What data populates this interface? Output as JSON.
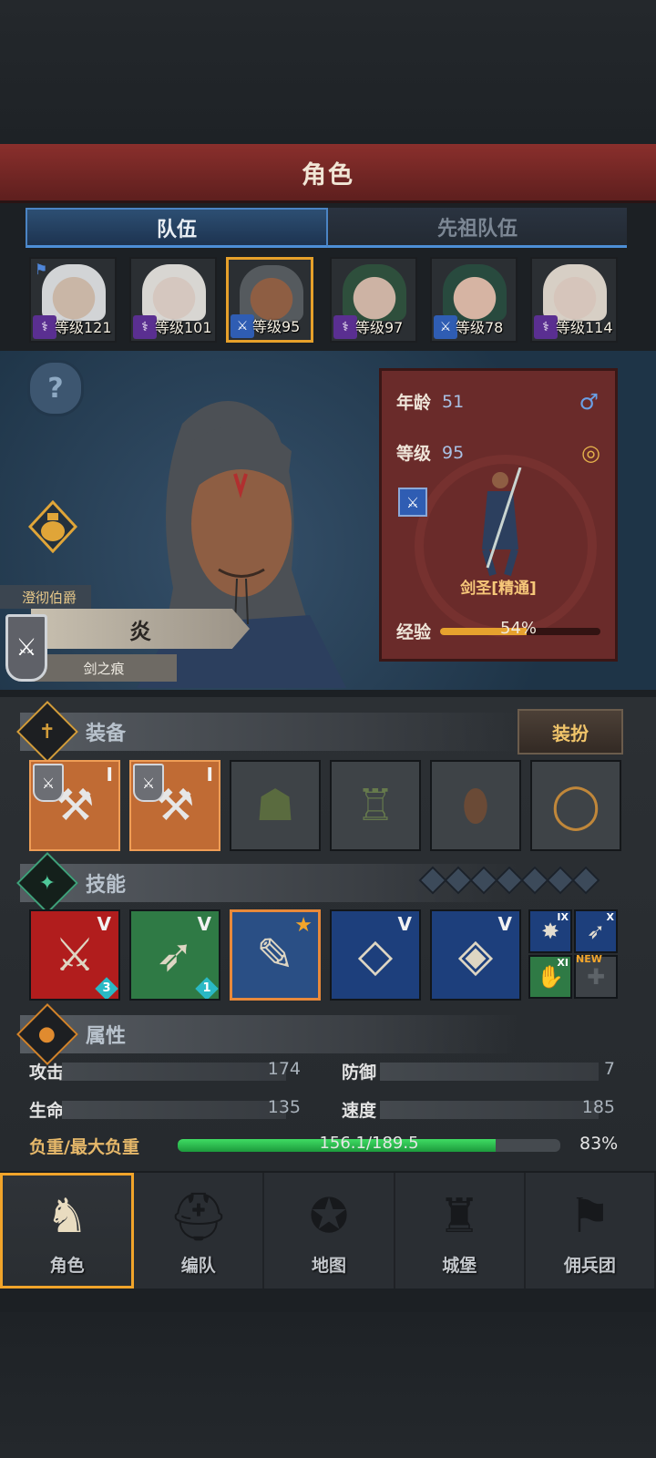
{
  "header": {
    "title": "角色"
  },
  "tabs": [
    {
      "label": "队伍",
      "active": true
    },
    {
      "label": "先祖队伍",
      "active": false
    }
  ],
  "party": [
    {
      "level_text": "等级121",
      "class_icon": "staff-icon",
      "flag": true,
      "hair": "#d2d4d6",
      "skin": "#c9b6a6"
    },
    {
      "level_text": "等级101",
      "class_icon": "staff-icon",
      "flag": false,
      "hair": "#d8d6d2",
      "skin": "#d5c7bf"
    },
    {
      "level_text": "等级95",
      "class_icon": "sword-icon",
      "flag": false,
      "hair": "#555a5e",
      "skin": "#8e5e43",
      "selected": true
    },
    {
      "level_text": "等级97",
      "class_icon": "staff-icon",
      "flag": false,
      "hair": "#2e4f3c",
      "skin": "#cdb3a4"
    },
    {
      "level_text": "等级78",
      "class_icon": "sword-icon",
      "flag": false,
      "hair": "#284a3e",
      "skin": "#d6b4a3"
    },
    {
      "level_text": "等级114",
      "class_icon": "staff-icon",
      "flag": false,
      "hair": "#d7cfc5",
      "skin": "#d6c5bb"
    }
  ],
  "hero": {
    "noble_title": "澄彻伯爵",
    "name": "炎",
    "epithet": "剑之痕"
  },
  "card": {
    "age_label": "年龄",
    "age": "51",
    "level_label": "等级",
    "level": "95",
    "class_name": "剑圣[精通]",
    "exp_label": "经验",
    "exp_pct_text": "54%",
    "exp_fraction": 0.54
  },
  "equipment": {
    "title": "装备",
    "dress_button": "装扮",
    "slots": [
      {
        "icon": "weapon-axe-icon",
        "tier": "I",
        "rarity": "orange"
      },
      {
        "icon": "weapon-axe-icon",
        "tier": "I",
        "rarity": "orange"
      },
      {
        "icon": "hood-icon",
        "tier": "",
        "rarity": "gray"
      },
      {
        "icon": "armor-icon",
        "tier": "",
        "rarity": "gray"
      },
      {
        "icon": "boots-icon",
        "tier": "",
        "rarity": "gray"
      },
      {
        "icon": "ring-icon",
        "tier": "",
        "rarity": "gray"
      }
    ]
  },
  "skills": {
    "title": "技能",
    "slots": [
      {
        "icon": "slash-skill-icon",
        "tier": "V",
        "count": "3",
        "color": "#b11d1d"
      },
      {
        "icon": "dash-skill-icon",
        "tier": "V",
        "count": "1",
        "color": "#2f7a45"
      },
      {
        "icon": "strike-skill-icon",
        "tier": "",
        "star": true,
        "color": "#2a4f85"
      },
      {
        "icon": "crystal-sword-icon",
        "tier": "V",
        "color": "#1d3f7c"
      },
      {
        "icon": "crystal-dash-icon",
        "tier": "V",
        "color": "#1d3f7c"
      }
    ],
    "small": [
      {
        "icon": "burst-skill-icon",
        "tier": "IX",
        "color": "#1d3f7c"
      },
      {
        "icon": "wing-skill-icon",
        "tier": "X",
        "color": "#1d3f7c"
      },
      {
        "icon": "claw-skill-icon",
        "tier": "XI",
        "color": "#2f7a45"
      },
      {
        "icon": "empty-slot-icon",
        "tier": "",
        "color": "#3d4247"
      }
    ],
    "new_tag": "NEW"
  },
  "attributes": {
    "title": "属性",
    "attack_label": "攻击",
    "attack": "174",
    "defense_label": "防御",
    "defense": "7",
    "hp_label": "生命",
    "hp": "135",
    "speed_label": "速度",
    "speed": "185",
    "load_label": "负重/最大负重",
    "load_text": "156.1/189.5",
    "load_fraction": 0.83,
    "load_pct": "83%"
  },
  "nav": [
    {
      "label": "角色",
      "icon": "knight-icon",
      "active": true
    },
    {
      "label": "编队",
      "icon": "helmet-icon",
      "active": false
    },
    {
      "label": "地图",
      "icon": "compass-map-icon",
      "active": false
    },
    {
      "label": "城堡",
      "icon": "castle-icon",
      "active": false
    },
    {
      "label": "佣兵团",
      "icon": "banner-fist-icon",
      "active": false
    }
  ],
  "colors": {
    "accent_orange": "#f1a42a",
    "tab_blue": "#4d8ed6",
    "header_red": "#8a2f2c"
  }
}
